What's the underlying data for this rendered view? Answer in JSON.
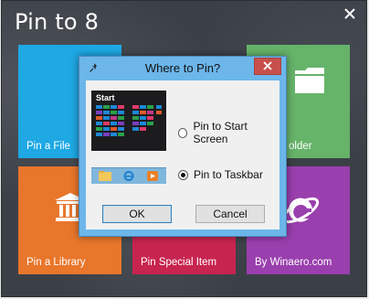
{
  "app": {
    "title": "Pin to 8",
    "close_icon": "close-icon"
  },
  "tiles": {
    "pin_file": {
      "label": "Pin a File",
      "color": "#1ea8e4"
    },
    "pin_folder": {
      "label": "older",
      "color": "#66b36a",
      "icon": "folder-icon"
    },
    "pin_library": {
      "label": "Pin a Library",
      "color": "#e8762b",
      "icon": "library-icon"
    },
    "pin_special": {
      "label": "Pin Special Item",
      "color": "#c7244f"
    },
    "winaero": {
      "label": "By Winaero.com",
      "color": "#9a3fae",
      "icon": "ie-logo-icon"
    }
  },
  "dialog": {
    "title": "Where to Pin?",
    "pin_icon": "pushpin-icon",
    "close_icon": "close-icon",
    "start_preview_label": "Start",
    "options": [
      {
        "label": "Pin to Start Screen",
        "checked": false
      },
      {
        "label": "Pin to Taskbar",
        "checked": true
      }
    ],
    "ok_label": "OK",
    "cancel_label": "Cancel"
  }
}
